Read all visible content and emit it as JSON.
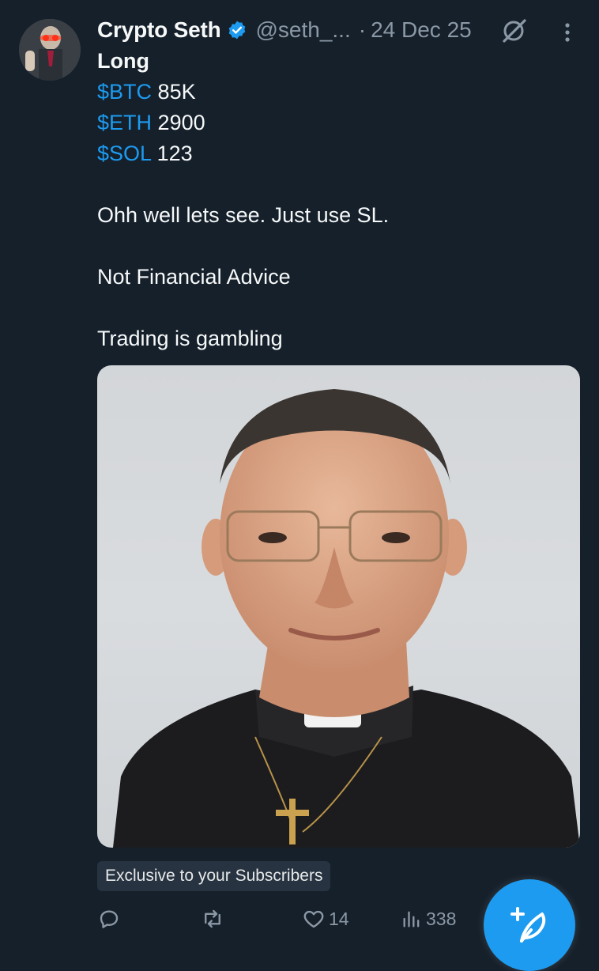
{
  "author": {
    "display_name": "Crypto Seth",
    "handle": "@seth_...",
    "separator": "·",
    "date": "24 Dec 25"
  },
  "tweet": {
    "line1": "Long",
    "positions": [
      {
        "cashtag": "$BTC",
        "value": "85K"
      },
      {
        "cashtag": "$ETH",
        "value": "2900"
      },
      {
        "cashtag": "$SOL",
        "value": "123"
      }
    ],
    "para1": "Ohh well lets see. Just use SL.",
    "para2": "Not Financial Advice",
    "para3": "Trading is gambling"
  },
  "badge": {
    "label": "Exclusive to your Subscribers"
  },
  "actions": {
    "reply": {
      "icon": "reply-icon",
      "count": ""
    },
    "repost": {
      "icon": "repost-icon",
      "count": ""
    },
    "like": {
      "icon": "heart-icon",
      "count": "14"
    },
    "views": {
      "icon": "views-icon",
      "count": "338"
    }
  },
  "colors": {
    "background": "#15202b",
    "accent": "#1d9bf0",
    "muted": "#8b98a5",
    "text": "#f7f9f9"
  }
}
